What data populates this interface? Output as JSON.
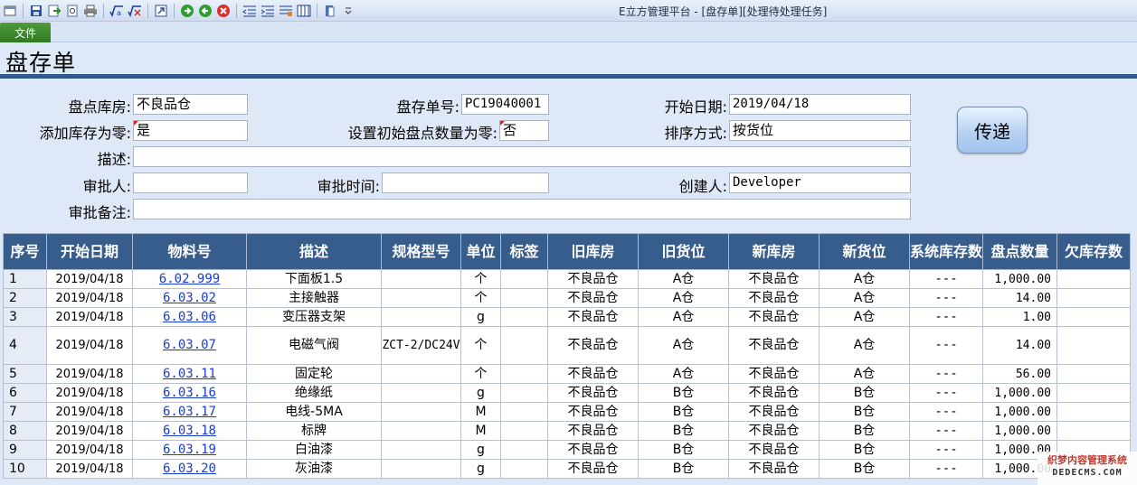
{
  "window": {
    "title": "E立方管理平台 - [盘存单][处理待处理任务]"
  },
  "toolbar": {
    "file_label": "文件"
  },
  "page": {
    "title": "盘存单"
  },
  "form": {
    "warehouse": {
      "label": "盘点库房:",
      "value": "不良品仓"
    },
    "order_no": {
      "label": "盘存单号:",
      "value": "PC19040001"
    },
    "start_date": {
      "label": "开始日期:",
      "value": "2019/04/18"
    },
    "add_zero": {
      "label": "添加库存为零:",
      "value": "是"
    },
    "init_zero": {
      "label": "设置初始盘点数量为零:",
      "value": "否"
    },
    "sort": {
      "label": "排序方式:",
      "value": "按货位"
    },
    "desc": {
      "label": "描述:",
      "value": ""
    },
    "approver": {
      "label": "审批人:",
      "value": ""
    },
    "approve_time": {
      "label": "审批时间:",
      "value": ""
    },
    "creator": {
      "label": "创建人:",
      "value": "Developer"
    },
    "approve_note": {
      "label": "审批备注:",
      "value": ""
    },
    "send_label": "传递"
  },
  "table": {
    "headers": [
      "序号",
      "开始日期",
      "物料号",
      "描述",
      "规格型号",
      "单位",
      "标签",
      "旧库房",
      "旧货位",
      "新库房",
      "新货位",
      "系统库存数",
      "盘点数量",
      "欠库存数"
    ],
    "rows": [
      {
        "seq": "1",
        "date": "2019/04/18",
        "mat": "6.02.999",
        "desc": "下面板1.5",
        "spec": "",
        "unit": "个",
        "tag": "",
        "old_wh": "不良品仓",
        "old_loc": "A仓",
        "new_wh": "不良品仓",
        "new_loc": "A仓",
        "sys": "---",
        "count": "1,000.00",
        "owe": ""
      },
      {
        "seq": "2",
        "date": "2019/04/18",
        "mat": "6.03.02",
        "desc": "主接触器",
        "spec": "",
        "unit": "个",
        "tag": "",
        "old_wh": "不良品仓",
        "old_loc": "A仓",
        "new_wh": "不良品仓",
        "new_loc": "A仓",
        "sys": "---",
        "count": "14.00",
        "owe": ""
      },
      {
        "seq": "3",
        "date": "2019/04/18",
        "mat": "6.03.06",
        "desc": "变压器支架",
        "spec": "",
        "unit": "g",
        "tag": "",
        "old_wh": "不良品仓",
        "old_loc": "A仓",
        "new_wh": "不良品仓",
        "new_loc": "A仓",
        "sys": "---",
        "count": "1.00",
        "owe": ""
      },
      {
        "seq": "4",
        "date": "2019/04/18",
        "mat": "6.03.07",
        "desc": "电磁气阀",
        "spec": "ZCT-2/DC24V",
        "unit": "个",
        "tag": "",
        "old_wh": "不良品仓",
        "old_loc": "A仓",
        "new_wh": "不良品仓",
        "new_loc": "A仓",
        "sys": "---",
        "count": "14.00",
        "owe": ""
      },
      {
        "seq": "5",
        "date": "2019/04/18",
        "mat": "6.03.11",
        "desc": "固定轮",
        "spec": "",
        "unit": "个",
        "tag": "",
        "old_wh": "不良品仓",
        "old_loc": "A仓",
        "new_wh": "不良品仓",
        "new_loc": "A仓",
        "sys": "---",
        "count": "56.00",
        "owe": ""
      },
      {
        "seq": "6",
        "date": "2019/04/18",
        "mat": "6.03.16",
        "desc": "绝缘纸",
        "spec": "",
        "unit": "g",
        "tag": "",
        "old_wh": "不良品仓",
        "old_loc": "B仓",
        "new_wh": "不良品仓",
        "new_loc": "B仓",
        "sys": "---",
        "count": "1,000.00",
        "owe": ""
      },
      {
        "seq": "7",
        "date": "2019/04/18",
        "mat": "6.03.17",
        "desc": "电线-5MA",
        "spec": "",
        "unit": "M",
        "tag": "",
        "old_wh": "不良品仓",
        "old_loc": "B仓",
        "new_wh": "不良品仓",
        "new_loc": "B仓",
        "sys": "---",
        "count": "1,000.00",
        "owe": ""
      },
      {
        "seq": "8",
        "date": "2019/04/18",
        "mat": "6.03.18",
        "desc": "标牌",
        "spec": "",
        "unit": "M",
        "tag": "",
        "old_wh": "不良品仓",
        "old_loc": "B仓",
        "new_wh": "不良品仓",
        "new_loc": "B仓",
        "sys": "---",
        "count": "1,000.00",
        "owe": ""
      },
      {
        "seq": "9",
        "date": "2019/04/18",
        "mat": "6.03.19",
        "desc": "白油漆",
        "spec": "",
        "unit": "g",
        "tag": "",
        "old_wh": "不良品仓",
        "old_loc": "B仓",
        "new_wh": "不良品仓",
        "new_loc": "B仓",
        "sys": "---",
        "count": "1,000.00",
        "owe": ""
      },
      {
        "seq": "10",
        "date": "2019/04/18",
        "mat": "6.03.20",
        "desc": "灰油漆",
        "spec": "",
        "unit": "g",
        "tag": "",
        "old_wh": "不良品仓",
        "old_loc": "B仓",
        "new_wh": "不良品仓",
        "new_loc": "B仓",
        "sys": "---",
        "count": "1,000.00",
        "owe": ""
      }
    ]
  },
  "watermark": {
    "line1": "织梦内容管理系统",
    "line2": "DEDECMS.COM"
  }
}
